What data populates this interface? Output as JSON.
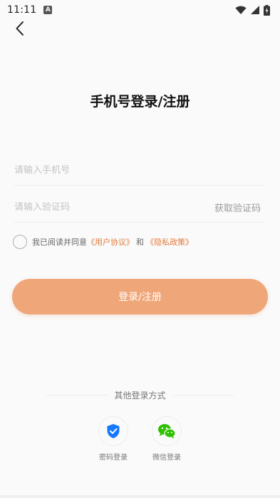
{
  "status_bar": {
    "time": "11:11",
    "notification_icon": "a-notification-icon",
    "icons": [
      "wifi-icon",
      "signal-icon",
      "battery-charging-icon"
    ]
  },
  "header": {
    "back_icon": "chevron-left-icon",
    "title": "手机号登录/注册"
  },
  "form": {
    "phone_placeholder": "请输入手机号",
    "code_placeholder": "请输入验证码",
    "get_code_label": "获取验证码",
    "agree_prefix": "我已阅读并同意",
    "user_agreement": "《用户协议》",
    "and": "和",
    "privacy_policy": "《隐私政策》",
    "submit_label": "登录/注册"
  },
  "other_login": {
    "title": "其他登录方式",
    "options": [
      {
        "label": "密码登录",
        "icon": "shield-check-icon"
      },
      {
        "label": "微信登录",
        "icon": "wechat-icon"
      }
    ]
  },
  "colors": {
    "accent": "#efa679",
    "link": "#e07a3c",
    "shield_blue": "#1677ff",
    "wechat_green": "#2dc100"
  }
}
